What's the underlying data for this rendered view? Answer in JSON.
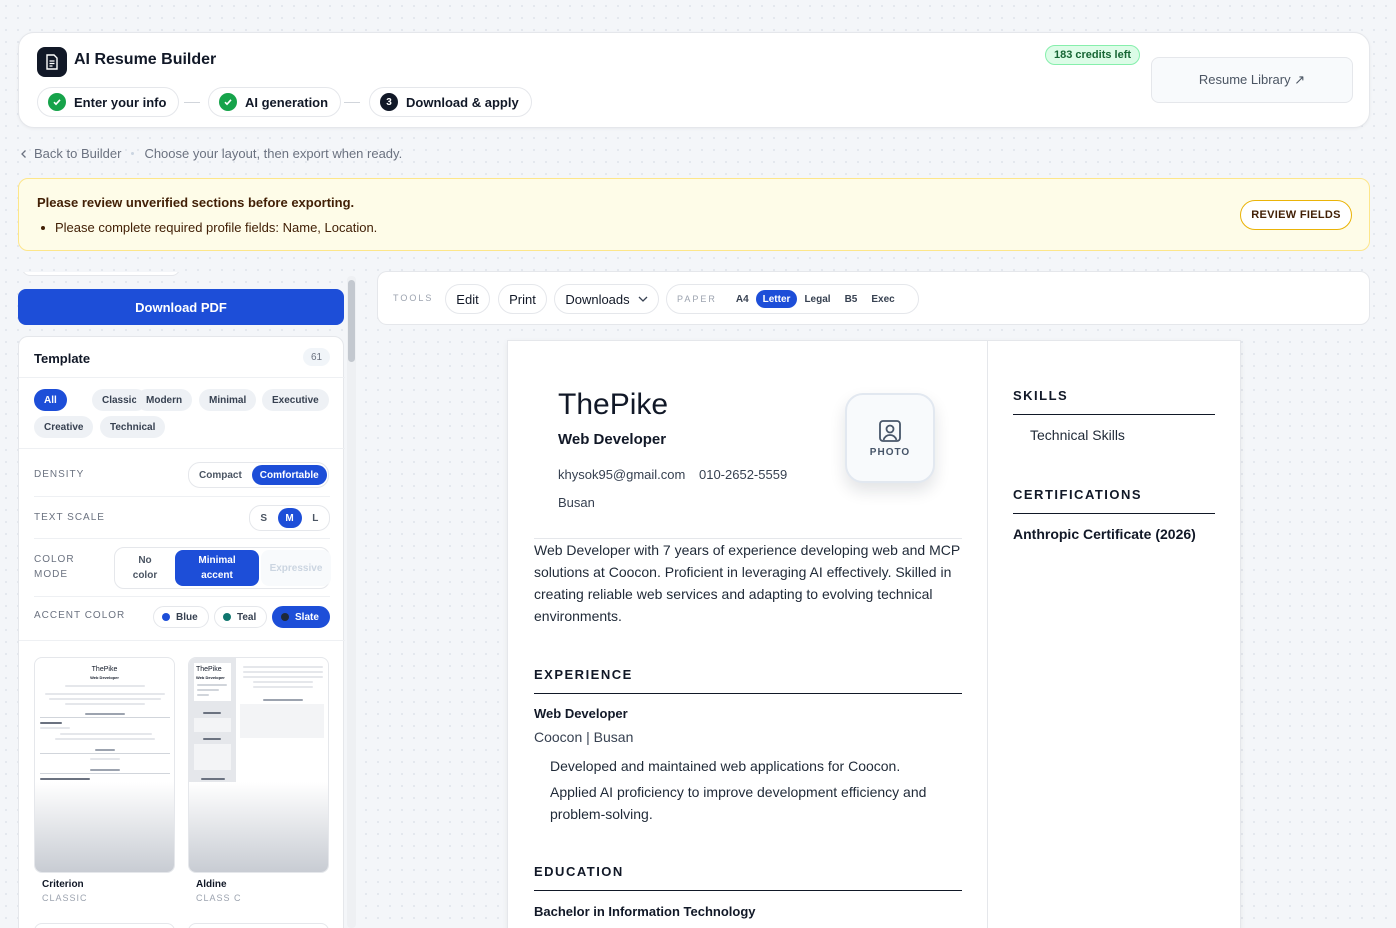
{
  "header": {
    "app_title": "AI Resume Builder",
    "steps": [
      {
        "label": "Enter your info",
        "status": "done"
      },
      {
        "label": "AI generation",
        "status": "done"
      },
      {
        "label": "Download & apply",
        "status": "current",
        "number": "3"
      }
    ],
    "credits": "183 credits left",
    "library_button": "Resume Library ↗"
  },
  "breadcrumb": {
    "back": "Back to Builder",
    "hint": "Choose your layout, then export when ready."
  },
  "alert": {
    "title": "Please review unverified sections before exporting.",
    "item": "Please complete required profile fields: Name, Location.",
    "button": "REVIEW FIELDS"
  },
  "sidebar": {
    "download_button": "Download PDF",
    "template_title": "Template",
    "template_count": "61",
    "filters": [
      "All",
      "Classic",
      "Modern",
      "Minimal",
      "Executive",
      "Creative",
      "Technical"
    ],
    "active_filter": "All",
    "density": {
      "label": "DENSITY",
      "options": [
        "Compact",
        "Comfortable"
      ],
      "selected": "Comfortable"
    },
    "text_scale": {
      "label": "TEXT SCALE",
      "options": [
        "S",
        "M",
        "L"
      ],
      "selected": "M"
    },
    "color_mode": {
      "label_line1": "COLOR",
      "label_line2": "MODE",
      "options": [
        [
          "No",
          "color"
        ],
        [
          "Minimal",
          "accent"
        ],
        [
          "Expressive",
          ""
        ]
      ],
      "selected": "Minimal accent"
    },
    "accent": {
      "label": "ACCENT COLOR",
      "options": [
        {
          "name": "Blue",
          "color": "#1d4ed8"
        },
        {
          "name": "Teal",
          "color": "#0f766e"
        },
        {
          "name": "Slate",
          "color": "#1e293b"
        }
      ],
      "selected": "Slate"
    },
    "templates": [
      {
        "name": "Criterion",
        "class": "CLASSIC"
      },
      {
        "name": "Aldine",
        "class": "CLASS C"
      }
    ]
  },
  "tools": {
    "label": "TOOLS",
    "edit": "Edit",
    "print": "Print",
    "downloads": "Downloads",
    "paper_label": "PAPER",
    "paper_options": [
      "A4",
      "Letter",
      "Legal",
      "B5",
      "Exec"
    ],
    "paper_selected": "Letter"
  },
  "resume": {
    "name": "ThePike",
    "role": "Web Developer",
    "email": "khysok95@gmail.com",
    "phone": "010-2652-5559",
    "location": "Busan",
    "photo_label": "PHOTO",
    "summary": "Web Developer with 7 years of experience developing web and MCP solutions at Coocon. Proficient in leveraging AI effectively. Skilled in creating reliable web services and adapting to evolving technical environments.",
    "experience_title": "EXPERIENCE",
    "job_title": "Web Developer",
    "company": "Coocon | Busan",
    "bullets": [
      "Developed and maintained web applications for Coocon.",
      "Applied AI proficiency to improve development efficiency and problem-solving."
    ],
    "education_title": "EDUCATION",
    "degree": "Bachelor in Information Technology",
    "skills_title": "SKILLS",
    "skills": "Technical Skills",
    "certifications_title": "CERTIFICATIONS",
    "certification": "Anthropic Certificate (2026)"
  },
  "colors": {
    "primary": "#1d4ed8",
    "success": "#16a34a",
    "warning_bg": "#fefce8"
  }
}
